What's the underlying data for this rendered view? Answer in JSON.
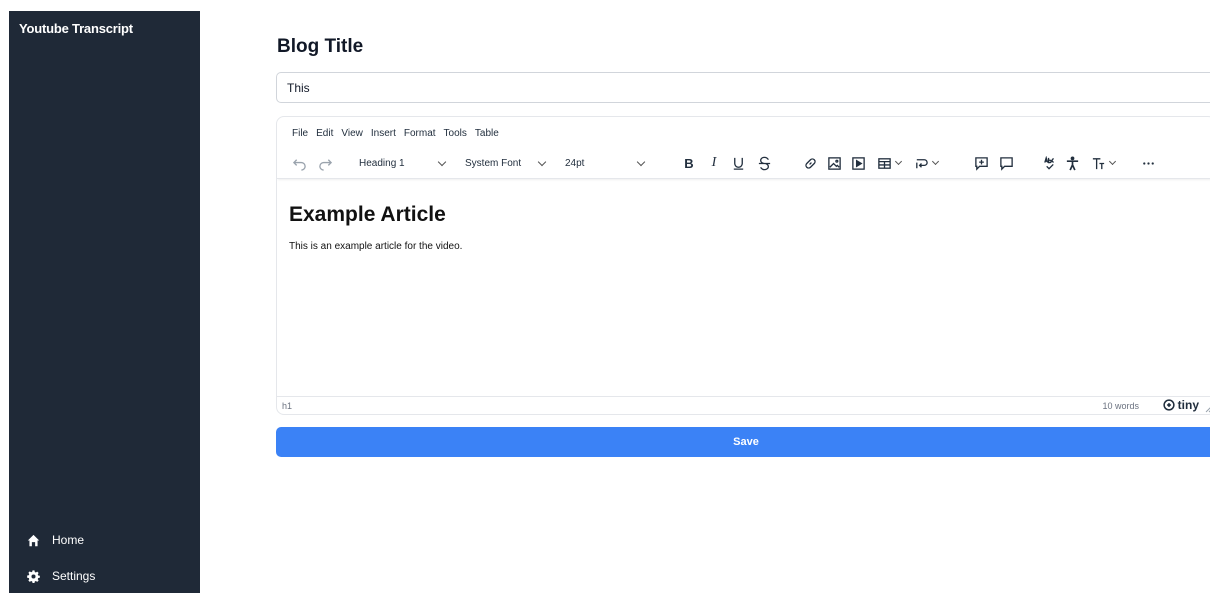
{
  "sidebar": {
    "app_title": "Youtube Transcript",
    "items": [
      {
        "label": "Home",
        "icon": "home-icon"
      },
      {
        "label": "Settings",
        "icon": "gear-icon"
      }
    ]
  },
  "main": {
    "blog_title_label": "Blog Title",
    "title_input_value": "This",
    "save_label": "Save"
  },
  "editor": {
    "menubar": [
      "File",
      "Edit",
      "View",
      "Insert",
      "Format",
      "Tools",
      "Table"
    ],
    "block_format": "Heading 1",
    "font_family": "System Font",
    "font_size": "24pt",
    "toolbar_icons": [
      "undo-icon",
      "redo-icon",
      "bold-icon",
      "italic-icon",
      "underline-icon",
      "strikethrough-icon",
      "link-icon",
      "image-icon",
      "media-icon",
      "table-icon",
      "line-height-icon",
      "add-comment-icon",
      "comment-icon",
      "spellcheck-icon",
      "accessibility-icon",
      "text-size-icon",
      "more-icon"
    ],
    "bold_label": "B",
    "italic_label": "I",
    "content": {
      "heading": "Example Article",
      "paragraph": "This is an example article for the video."
    },
    "status": {
      "path": "h1",
      "word_count": "10 words",
      "brand": "tiny"
    }
  },
  "colors": {
    "sidebar_bg": "#1f2937",
    "save_button": "#3b82f6"
  }
}
